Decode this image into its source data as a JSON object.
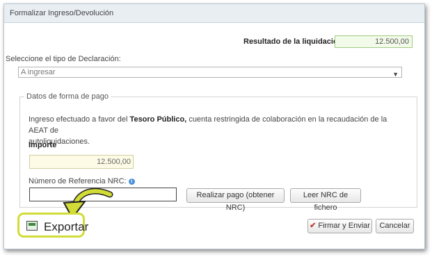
{
  "dialog": {
    "title": "Formalizar Ingreso/Devolución"
  },
  "resultado": {
    "label": "Resultado de la liquidación",
    "value": "12.500,00"
  },
  "tipo_declaracion": {
    "label": "Seleccione el tipo de Declaración:",
    "selected": "A ingresar"
  },
  "forma_pago": {
    "legend": "Datos de forma de pago",
    "description_prefix": "Ingreso efectuado a favor del",
    "description_bold": "Tesoro Público,",
    "description_line1_suffix": "cuenta restringida de colaboración en la recaudación de la AEAT de",
    "description_line2": "autoliquidaciones.",
    "importe_label": "Importe",
    "importe_value": "12.500,00",
    "nrc_label": "Número de Referencia  NRC:",
    "nrc_value": "",
    "realizar_pago_label": "Realizar pago (obtener NRC)",
    "leer_nrc_label": "Leer NRC de fichero"
  },
  "footer": {
    "exportar_label": "Exportar",
    "firmar_label": "Firmar y Enviar",
    "cancelar_label": "Cancelar"
  },
  "icons": [
    "info-icon",
    "export-icon",
    "sign-icon",
    "dropdown-arrow-icon",
    "pointer-arrow-icon"
  ],
  "colors": {
    "highlight": "#d2dc37",
    "green_field": "#f2fbe9",
    "yellow_field": "#fdfbe6",
    "info_blue": "#4a90d9"
  }
}
